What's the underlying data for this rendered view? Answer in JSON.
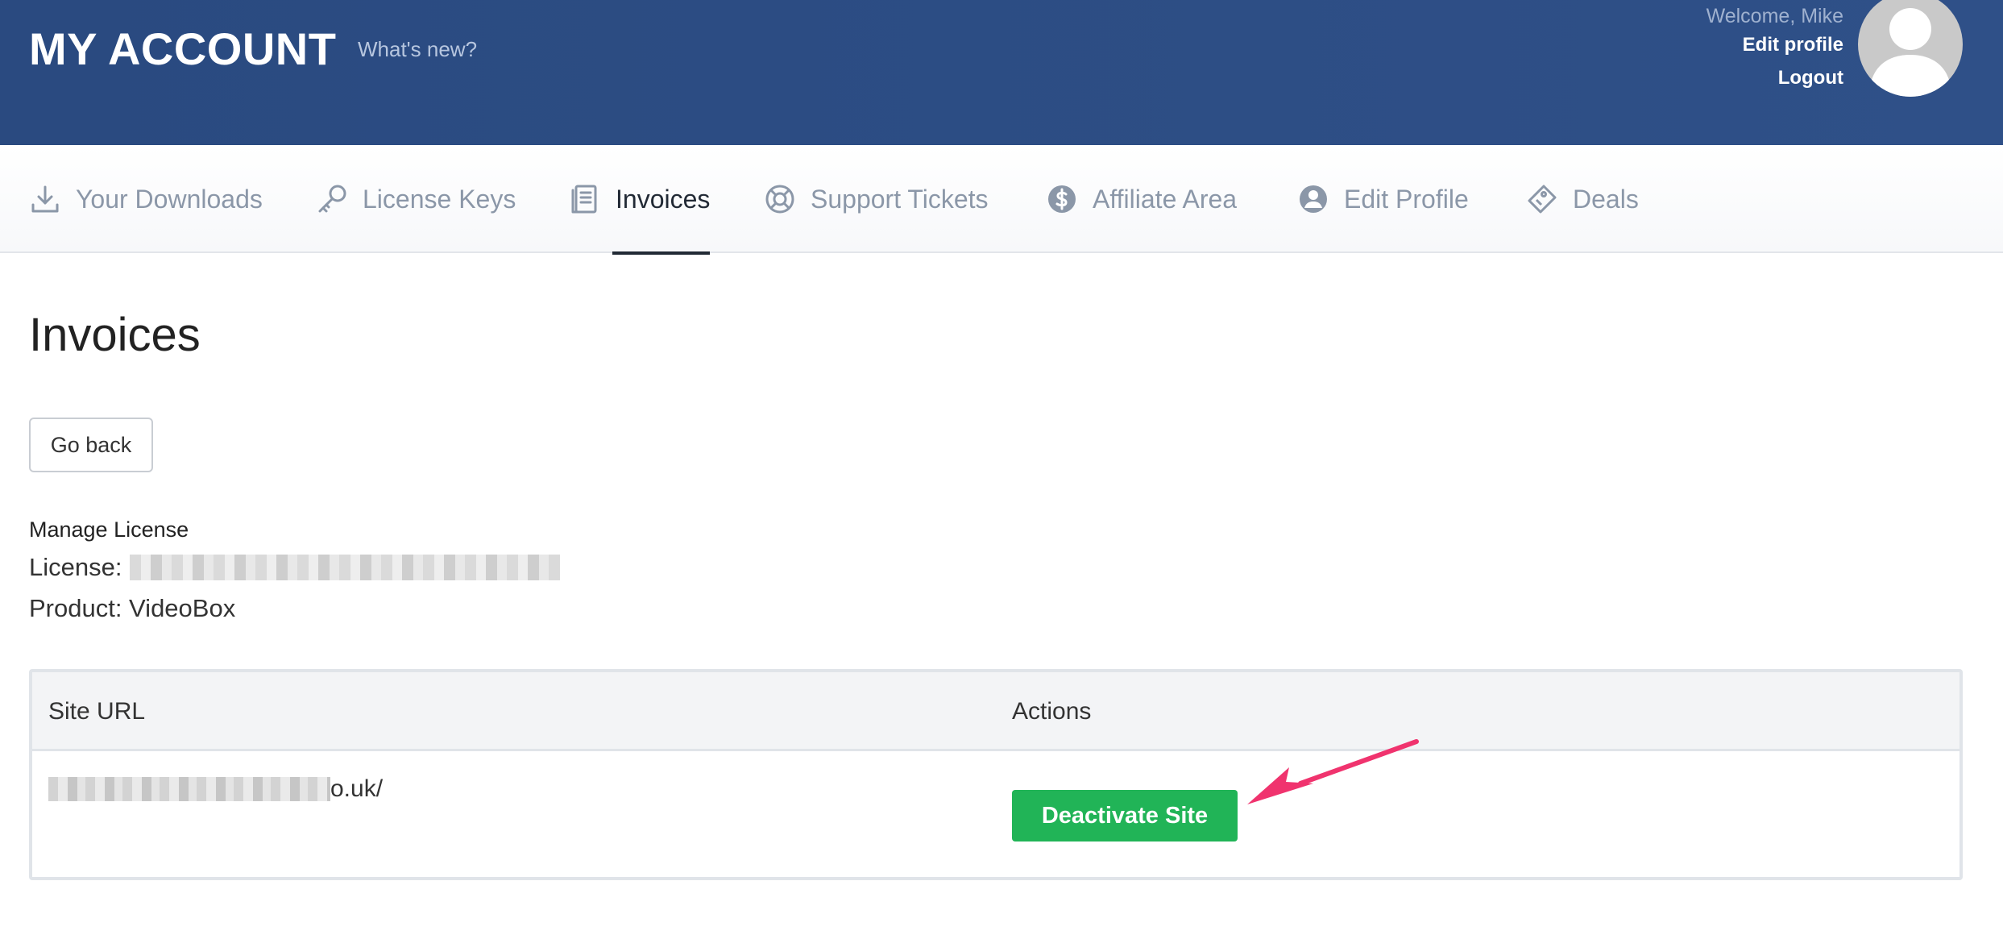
{
  "header": {
    "brand": "MY ACCOUNT",
    "whats_new": "What's new?",
    "welcome": "Welcome, Mike",
    "edit_profile": "Edit profile",
    "logout": "Logout"
  },
  "tabs": [
    {
      "label": "Your Downloads",
      "icon": "download-icon"
    },
    {
      "label": "License Keys",
      "icon": "key-icon"
    },
    {
      "label": "Invoices",
      "icon": "invoice-icon",
      "active": true
    },
    {
      "label": "Support Tickets",
      "icon": "lifebuoy-icon"
    },
    {
      "label": "Affiliate Area",
      "icon": "dollar-icon"
    },
    {
      "label": "Edit Profile",
      "icon": "user-circle-icon"
    },
    {
      "label": "Deals",
      "icon": "tag-icon"
    }
  ],
  "main": {
    "title": "Invoices",
    "back_label": "Go back",
    "manage_label": "Manage License",
    "license_label": "License:",
    "product_label": "Product: VideoBox"
  },
  "table": {
    "headers": [
      "Site URL",
      "Actions"
    ],
    "rows": [
      {
        "url_suffix": "o.uk/",
        "action": "Deactivate Site"
      }
    ]
  },
  "colors": {
    "header_bg": "#2d4d85",
    "active_tab": "#222a35",
    "button_green": "#21b457",
    "annotation_arrow": "#f0336e"
  }
}
